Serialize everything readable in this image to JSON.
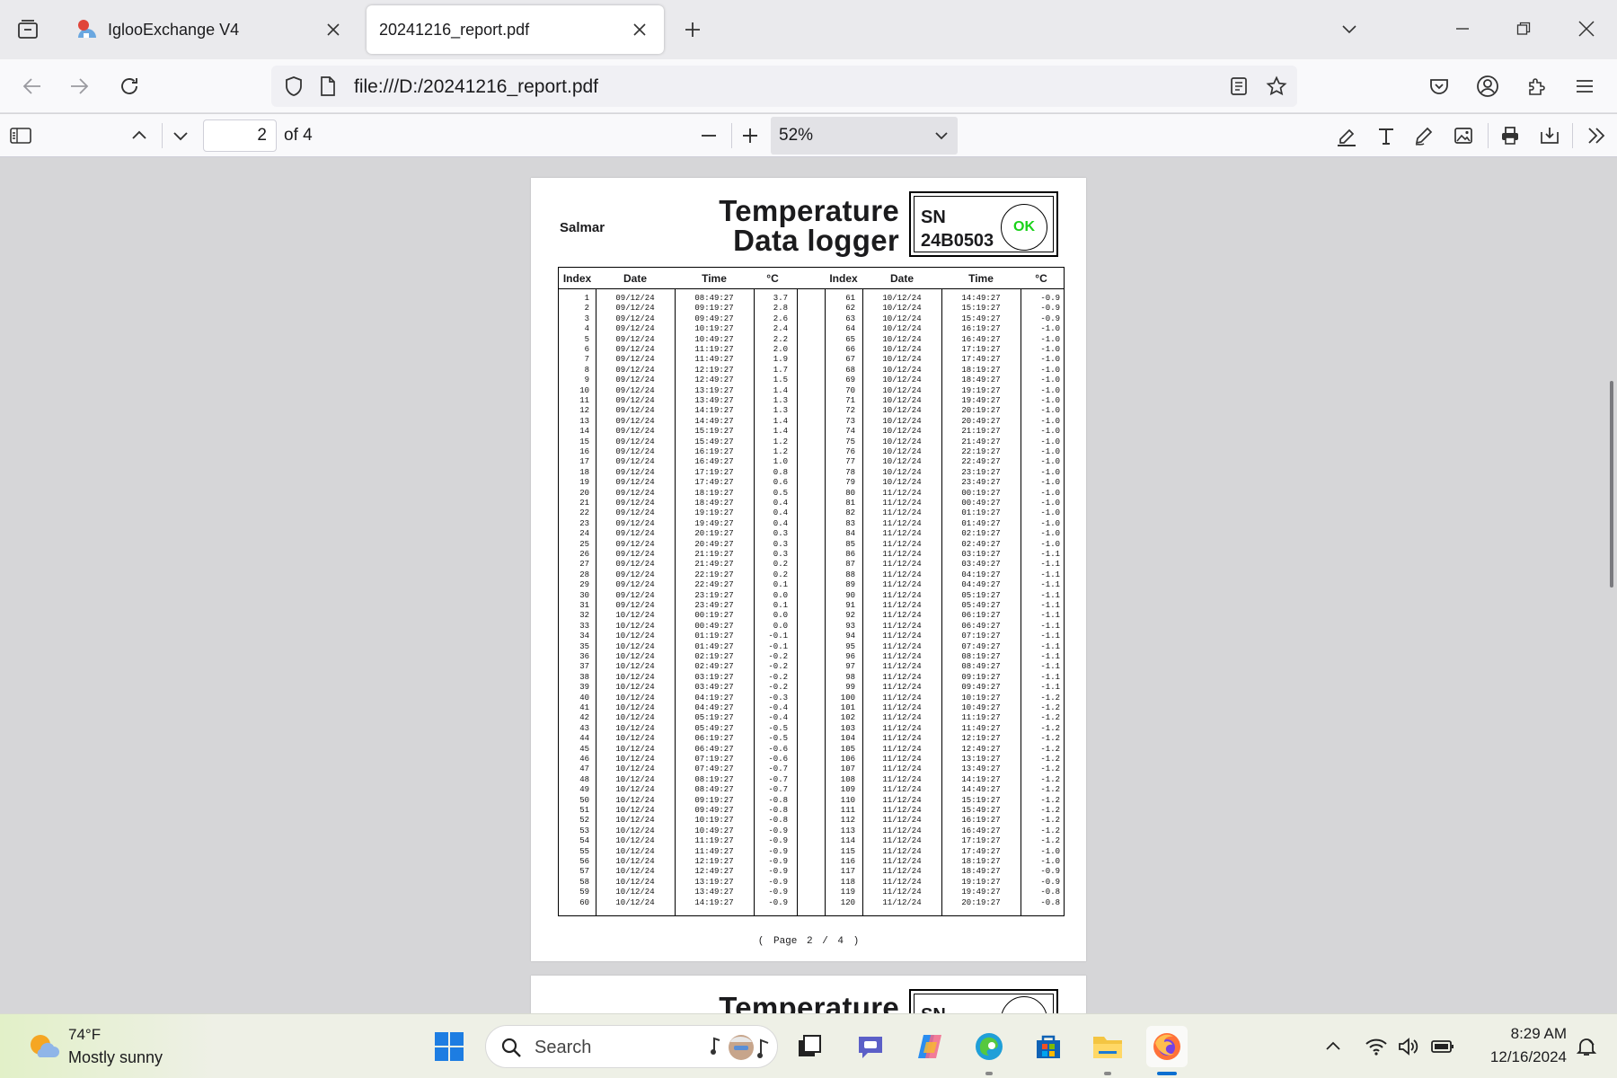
{
  "browser": {
    "tabs": [
      {
        "title": "IglooExchange V4",
        "active": false
      },
      {
        "title": "20241216_report.pdf",
        "active": true
      }
    ],
    "url": "file:///D:/20241216_report.pdf"
  },
  "pdf_toolbar": {
    "current_page": "2",
    "page_count_label": "of 4",
    "zoom": "52%"
  },
  "report": {
    "company": "Salmar",
    "title_line1": "Temperature",
    "title_line2": "Data logger",
    "sn_label": "SN",
    "sn_value": "24B0503",
    "status": "OK",
    "headers": [
      "Index",
      "Date",
      "Time",
      "°C",
      "Index",
      "Date",
      "Time",
      "°C"
    ],
    "rows_left": [
      [
        "1",
        "09/12/24",
        "08:49:27",
        "3.7"
      ],
      [
        "2",
        "09/12/24",
        "09:19:27",
        "2.8"
      ],
      [
        "3",
        "09/12/24",
        "09:49:27",
        "2.6"
      ],
      [
        "4",
        "09/12/24",
        "10:19:27",
        "2.4"
      ],
      [
        "5",
        "09/12/24",
        "10:49:27",
        "2.2"
      ],
      [
        "6",
        "09/12/24",
        "11:19:27",
        "2.0"
      ],
      [
        "7",
        "09/12/24",
        "11:49:27",
        "1.9"
      ],
      [
        "8",
        "09/12/24",
        "12:19:27",
        "1.7"
      ],
      [
        "9",
        "09/12/24",
        "12:49:27",
        "1.5"
      ],
      [
        "10",
        "09/12/24",
        "13:19:27",
        "1.4"
      ],
      [
        "11",
        "09/12/24",
        "13:49:27",
        "1.3"
      ],
      [
        "12",
        "09/12/24",
        "14:19:27",
        "1.3"
      ],
      [
        "13",
        "09/12/24",
        "14:49:27",
        "1.4"
      ],
      [
        "14",
        "09/12/24",
        "15:19:27",
        "1.4"
      ],
      [
        "15",
        "09/12/24",
        "15:49:27",
        "1.2"
      ],
      [
        "16",
        "09/12/24",
        "16:19:27",
        "1.2"
      ],
      [
        "17",
        "09/12/24",
        "16:49:27",
        "1.0"
      ],
      [
        "18",
        "09/12/24",
        "17:19:27",
        "0.8"
      ],
      [
        "19",
        "09/12/24",
        "17:49:27",
        "0.6"
      ],
      [
        "20",
        "09/12/24",
        "18:19:27",
        "0.5"
      ],
      [
        "21",
        "09/12/24",
        "18:49:27",
        "0.4"
      ],
      [
        "22",
        "09/12/24",
        "19:19:27",
        "0.4"
      ],
      [
        "23",
        "09/12/24",
        "19:49:27",
        "0.4"
      ],
      [
        "24",
        "09/12/24",
        "20:19:27",
        "0.3"
      ],
      [
        "25",
        "09/12/24",
        "20:49:27",
        "0.3"
      ],
      [
        "26",
        "09/12/24",
        "21:19:27",
        "0.3"
      ],
      [
        "27",
        "09/12/24",
        "21:49:27",
        "0.2"
      ],
      [
        "28",
        "09/12/24",
        "22:19:27",
        "0.2"
      ],
      [
        "29",
        "09/12/24",
        "22:49:27",
        "0.1"
      ],
      [
        "30",
        "09/12/24",
        "23:19:27",
        "0.0"
      ],
      [
        "31",
        "09/12/24",
        "23:49:27",
        "0.1"
      ],
      [
        "32",
        "10/12/24",
        "00:19:27",
        "0.0"
      ],
      [
        "33",
        "10/12/24",
        "00:49:27",
        "0.0"
      ],
      [
        "34",
        "10/12/24",
        "01:19:27",
        "-0.1"
      ],
      [
        "35",
        "10/12/24",
        "01:49:27",
        "-0.1"
      ],
      [
        "36",
        "10/12/24",
        "02:19:27",
        "-0.2"
      ],
      [
        "37",
        "10/12/24",
        "02:49:27",
        "-0.2"
      ],
      [
        "38",
        "10/12/24",
        "03:19:27",
        "-0.2"
      ],
      [
        "39",
        "10/12/24",
        "03:49:27",
        "-0.2"
      ],
      [
        "40",
        "10/12/24",
        "04:19:27",
        "-0.3"
      ],
      [
        "41",
        "10/12/24",
        "04:49:27",
        "-0.4"
      ],
      [
        "42",
        "10/12/24",
        "05:19:27",
        "-0.4"
      ],
      [
        "43",
        "10/12/24",
        "05:49:27",
        "-0.5"
      ],
      [
        "44",
        "10/12/24",
        "06:19:27",
        "-0.5"
      ],
      [
        "45",
        "10/12/24",
        "06:49:27",
        "-0.6"
      ],
      [
        "46",
        "10/12/24",
        "07:19:27",
        "-0.6"
      ],
      [
        "47",
        "10/12/24",
        "07:49:27",
        "-0.7"
      ],
      [
        "48",
        "10/12/24",
        "08:19:27",
        "-0.7"
      ],
      [
        "49",
        "10/12/24",
        "08:49:27",
        "-0.7"
      ],
      [
        "50",
        "10/12/24",
        "09:19:27",
        "-0.8"
      ],
      [
        "51",
        "10/12/24",
        "09:49:27",
        "-0.8"
      ],
      [
        "52",
        "10/12/24",
        "10:19:27",
        "-0.8"
      ],
      [
        "53",
        "10/12/24",
        "10:49:27",
        "-0.9"
      ],
      [
        "54",
        "10/12/24",
        "11:19:27",
        "-0.9"
      ],
      [
        "55",
        "10/12/24",
        "11:49:27",
        "-0.9"
      ],
      [
        "56",
        "10/12/24",
        "12:19:27",
        "-0.9"
      ],
      [
        "57",
        "10/12/24",
        "12:49:27",
        "-0.9"
      ],
      [
        "58",
        "10/12/24",
        "13:19:27",
        "-0.9"
      ],
      [
        "59",
        "10/12/24",
        "13:49:27",
        "-0.9"
      ],
      [
        "60",
        "10/12/24",
        "14:19:27",
        "-0.9"
      ]
    ],
    "rows_right": [
      [
        "61",
        "10/12/24",
        "14:49:27",
        "-0.9"
      ],
      [
        "62",
        "10/12/24",
        "15:19:27",
        "-0.9"
      ],
      [
        "63",
        "10/12/24",
        "15:49:27",
        "-0.9"
      ],
      [
        "64",
        "10/12/24",
        "16:19:27",
        "-1.0"
      ],
      [
        "65",
        "10/12/24",
        "16:49:27",
        "-1.0"
      ],
      [
        "66",
        "10/12/24",
        "17:19:27",
        "-1.0"
      ],
      [
        "67",
        "10/12/24",
        "17:49:27",
        "-1.0"
      ],
      [
        "68",
        "10/12/24",
        "18:19:27",
        "-1.0"
      ],
      [
        "69",
        "10/12/24",
        "18:49:27",
        "-1.0"
      ],
      [
        "70",
        "10/12/24",
        "19:19:27",
        "-1.0"
      ],
      [
        "71",
        "10/12/24",
        "19:49:27",
        "-1.0"
      ],
      [
        "72",
        "10/12/24",
        "20:19:27",
        "-1.0"
      ],
      [
        "73",
        "10/12/24",
        "20:49:27",
        "-1.0"
      ],
      [
        "74",
        "10/12/24",
        "21:19:27",
        "-1.0"
      ],
      [
        "75",
        "10/12/24",
        "21:49:27",
        "-1.0"
      ],
      [
        "76",
        "10/12/24",
        "22:19:27",
        "-1.0"
      ],
      [
        "77",
        "10/12/24",
        "22:49:27",
        "-1.0"
      ],
      [
        "78",
        "10/12/24",
        "23:19:27",
        "-1.0"
      ],
      [
        "79",
        "10/12/24",
        "23:49:27",
        "-1.0"
      ],
      [
        "80",
        "11/12/24",
        "00:19:27",
        "-1.0"
      ],
      [
        "81",
        "11/12/24",
        "00:49:27",
        "-1.0"
      ],
      [
        "82",
        "11/12/24",
        "01:19:27",
        "-1.0"
      ],
      [
        "83",
        "11/12/24",
        "01:49:27",
        "-1.0"
      ],
      [
        "84",
        "11/12/24",
        "02:19:27",
        "-1.0"
      ],
      [
        "85",
        "11/12/24",
        "02:49:27",
        "-1.0"
      ],
      [
        "86",
        "11/12/24",
        "03:19:27",
        "-1.1"
      ],
      [
        "87",
        "11/12/24",
        "03:49:27",
        "-1.1"
      ],
      [
        "88",
        "11/12/24",
        "04:19:27",
        "-1.1"
      ],
      [
        "89",
        "11/12/24",
        "04:49:27",
        "-1.1"
      ],
      [
        "90",
        "11/12/24",
        "05:19:27",
        "-1.1"
      ],
      [
        "91",
        "11/12/24",
        "05:49:27",
        "-1.1"
      ],
      [
        "92",
        "11/12/24",
        "06:19:27",
        "-1.1"
      ],
      [
        "93",
        "11/12/24",
        "06:49:27",
        "-1.1"
      ],
      [
        "94",
        "11/12/24",
        "07:19:27",
        "-1.1"
      ],
      [
        "95",
        "11/12/24",
        "07:49:27",
        "-1.1"
      ],
      [
        "96",
        "11/12/24",
        "08:19:27",
        "-1.1"
      ],
      [
        "97",
        "11/12/24",
        "08:49:27",
        "-1.1"
      ],
      [
        "98",
        "11/12/24",
        "09:19:27",
        "-1.1"
      ],
      [
        "99",
        "11/12/24",
        "09:49:27",
        "-1.1"
      ],
      [
        "100",
        "11/12/24",
        "10:19:27",
        "-1.2"
      ],
      [
        "101",
        "11/12/24",
        "10:49:27",
        "-1.2"
      ],
      [
        "102",
        "11/12/24",
        "11:19:27",
        "-1.2"
      ],
      [
        "103",
        "11/12/24",
        "11:49:27",
        "-1.2"
      ],
      [
        "104",
        "11/12/24",
        "12:19:27",
        "-1.2"
      ],
      [
        "105",
        "11/12/24",
        "12:49:27",
        "-1.2"
      ],
      [
        "106",
        "11/12/24",
        "13:19:27",
        "-1.2"
      ],
      [
        "107",
        "11/12/24",
        "13:49:27",
        "-1.2"
      ],
      [
        "108",
        "11/12/24",
        "14:19:27",
        "-1.2"
      ],
      [
        "109",
        "11/12/24",
        "14:49:27",
        "-1.2"
      ],
      [
        "110",
        "11/12/24",
        "15:19:27",
        "-1.2"
      ],
      [
        "111",
        "11/12/24",
        "15:49:27",
        "-1.2"
      ],
      [
        "112",
        "11/12/24",
        "16:19:27",
        "-1.2"
      ],
      [
        "113",
        "11/12/24",
        "16:49:27",
        "-1.2"
      ],
      [
        "114",
        "11/12/24",
        "17:19:27",
        "-1.2"
      ],
      [
        "115",
        "11/12/24",
        "17:49:27",
        "-1.0"
      ],
      [
        "116",
        "11/12/24",
        "18:19:27",
        "-1.0"
      ],
      [
        "117",
        "11/12/24",
        "18:49:27",
        "-0.9"
      ],
      [
        "118",
        "11/12/24",
        "19:19:27",
        "-0.9"
      ],
      [
        "119",
        "11/12/24",
        "19:49:27",
        "-0.8"
      ],
      [
        "120",
        "11/12/24",
        "20:19:27",
        "-0.8"
      ]
    ],
    "footer": "( Page 2 / 4 )"
  },
  "next_page": {
    "title_line1": "Temperature",
    "sn_label": "SN"
  },
  "taskbar": {
    "weather_temp": "74°F",
    "weather_desc": "Mostly sunny",
    "search_placeholder": "Search",
    "time": "8:29 AM",
    "date": "12/16/2024"
  },
  "colors": {
    "ok_green": "#19d219",
    "viewer_bg": "#d6d6d8",
    "tab_strip": "#eaeaed",
    "taskbar_accent": "#0b6fd0"
  }
}
